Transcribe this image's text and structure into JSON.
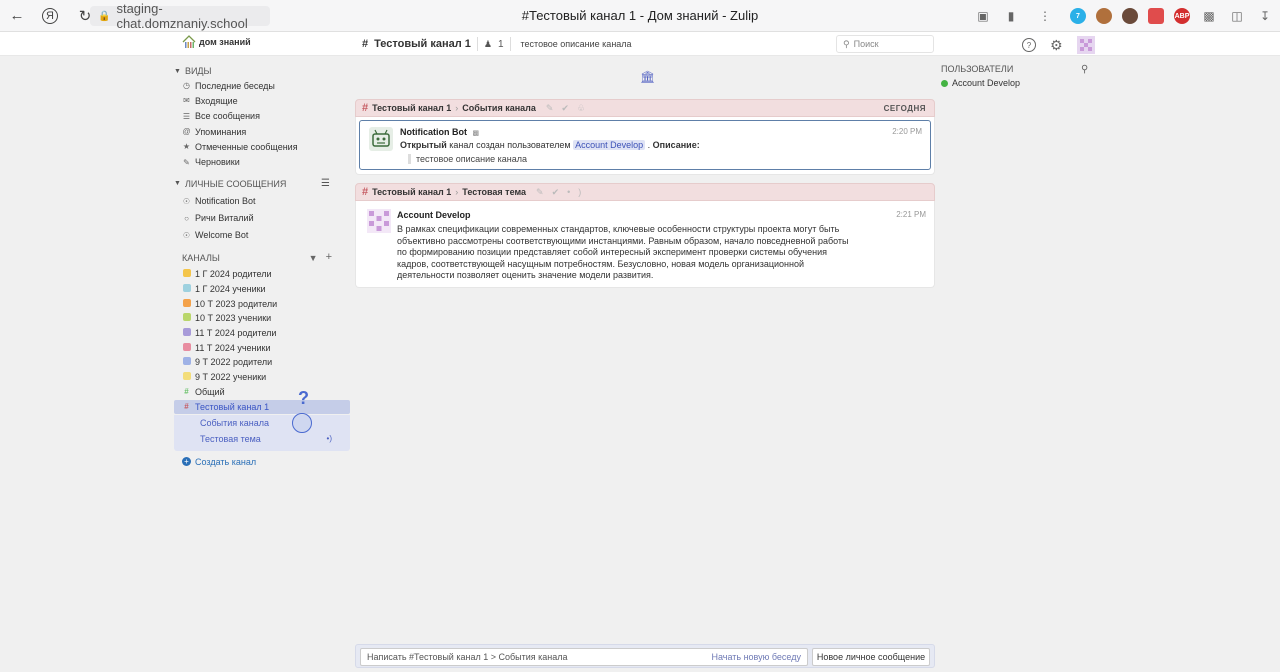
{
  "browser": {
    "url": "staging-chat.domznaniy.school",
    "tab_title": "#Тестовый канал 1 - Дом знаний - Zulip",
    "ext_abp": "ABP"
  },
  "header": {
    "logo_text": "дом знаний",
    "channel_name": "Тестовый канал 1",
    "subscriber_count": "1",
    "channel_description": "тестовое описание канала",
    "search_placeholder": "Поиск"
  },
  "sidebar": {
    "views_title": "ВИДЫ",
    "views": [
      {
        "label": "Последние беседы",
        "icon": "clock-icon"
      },
      {
        "label": "Входящие",
        "icon": "inbox-icon"
      },
      {
        "label": "Все сообщения",
        "icon": "messages-icon"
      },
      {
        "label": "Упоминания",
        "icon": "at-icon"
      },
      {
        "label": "Отмеченные сообщения",
        "icon": "star-icon"
      },
      {
        "label": "Черновики",
        "icon": "drafts-icon"
      }
    ],
    "dm_title": "ЛИЧНЫЕ СООБЩЕНИЯ",
    "dms": [
      {
        "label": "Notification Bot",
        "icon": "bot-icon"
      },
      {
        "label": "Ричи Виталий",
        "icon": "offline-circle-icon"
      },
      {
        "label": "Welcome Bot",
        "icon": "bot-icon"
      }
    ],
    "channels_title": "КАНАЛЫ",
    "channels": [
      {
        "label": "1 Г 2024 родители",
        "color": "#f4c54a"
      },
      {
        "label": "1 Г 2024 ученики",
        "color": "#9ed1df"
      },
      {
        "label": "10 Т 2023 родители",
        "color": "#f4a24a"
      },
      {
        "label": "10 Т 2023 ученики",
        "color": "#b9d66b"
      },
      {
        "label": "11 Т 2024 родители",
        "color": "#a89bd9"
      },
      {
        "label": "11 Т 2024 ученики",
        "color": "#e88da0"
      },
      {
        "label": "9 Т 2022 родители",
        "color": "#9fb2e6"
      },
      {
        "label": "9 Т 2022 ученики",
        "color": "#f3dd7a"
      },
      {
        "label": "Общий",
        "color": "#6bc26b"
      }
    ],
    "selected_channel": "Тестовый канал 1",
    "topics": [
      {
        "label": "События канала"
      },
      {
        "label": "Тестовая тема"
      }
    ],
    "create_channel": "Создать канал"
  },
  "messages": {
    "group1": {
      "channel": "Тестовый канал 1",
      "topic": "События канала",
      "date": "СЕГОДНЯ",
      "sender": "Notification Bot",
      "time": "2:20 PM",
      "text_bold": "Открытый",
      "text_mid": " канал создан пользователем ",
      "mention": "Account Develop",
      "text_after": " . ",
      "desc_label": "Описание:",
      "quote": "тестовое описание канала"
    },
    "group2": {
      "channel": "Тестовый канал 1",
      "topic": "Тестовая тема",
      "sender": "Account Develop",
      "time": "2:21 PM",
      "lines": [
        "В рамках спецификации современных стандартов, ключевые особенности структуры проекта могут быть",
        "объективно рассмотрены соответствующими инстанциями. Равным образом, начало повседневной работы",
        "по формированию позиции представляет собой интересный эксперимент проверки системы обучения",
        "кадров, соответствующей насущным потребностям. Безусловно, новая модель организационной",
        "деятельности позволяет оценить значение модели развития."
      ]
    }
  },
  "right_sidebar": {
    "title": "ПОЛЬЗОВАТЕЛИ",
    "users": [
      {
        "name": "Account Develop",
        "status_color": "#44b343"
      }
    ]
  },
  "compose": {
    "placeholder": "Написать #Тестовый канал 1 > События канала",
    "new_conversation": "Начать новую беседу",
    "new_dm": "Новое личное сообщение"
  },
  "cursor": {
    "mark": "?"
  }
}
